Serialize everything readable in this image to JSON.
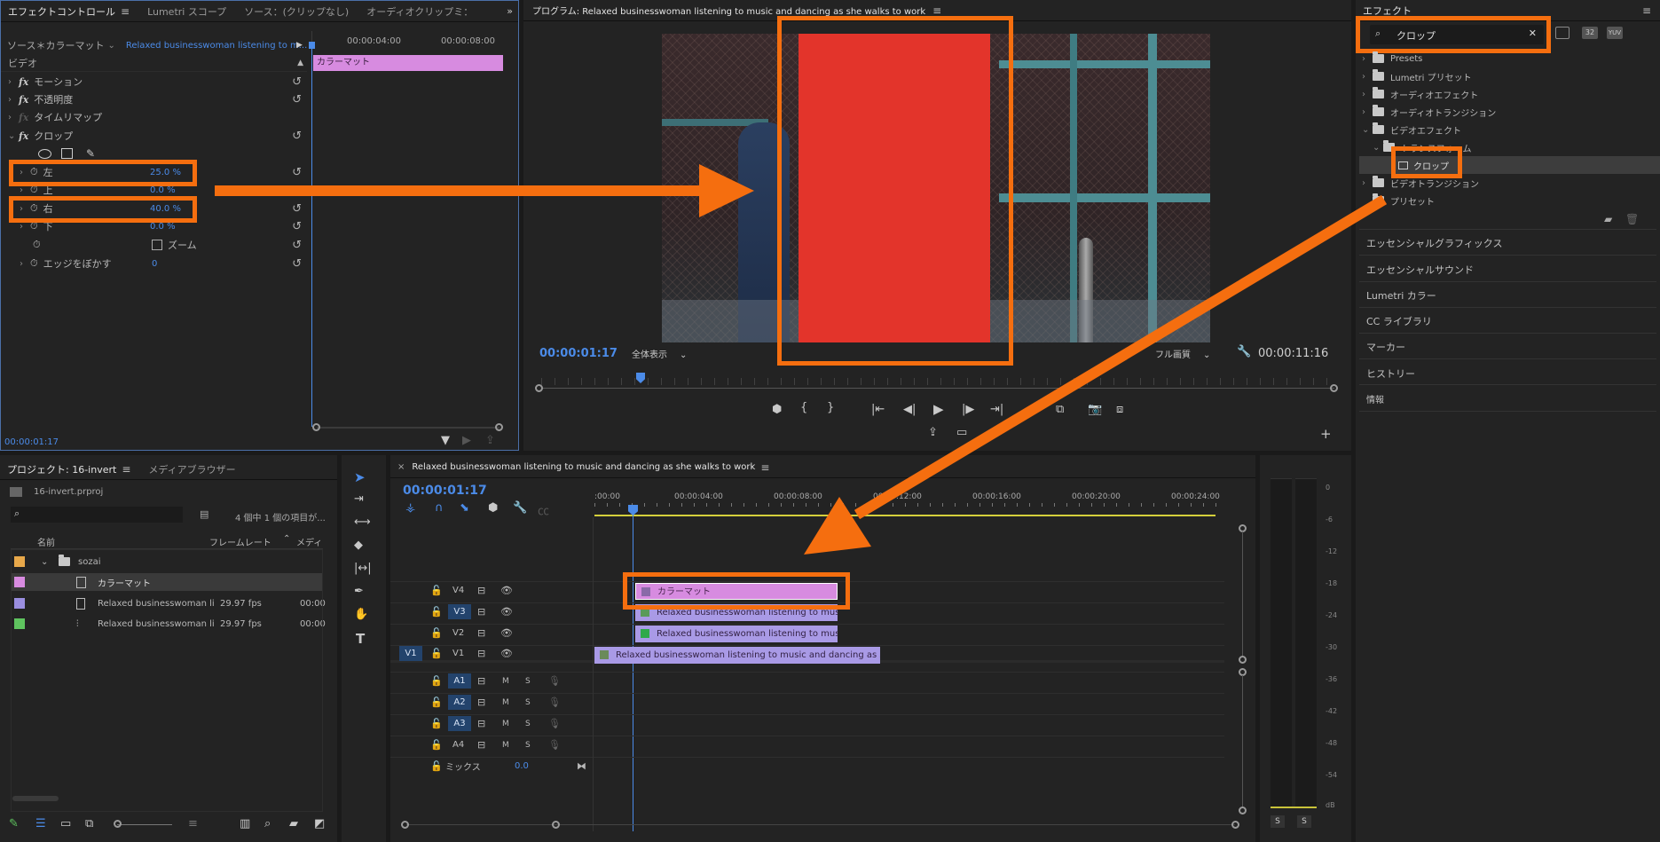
{
  "effect_controls": {
    "tabs": [
      "エフェクトコントロール",
      "Lumetri スコープ",
      "ソース：(クリップなし)",
      "オーディオクリップミ："
    ],
    "source_label": "ソース＊カラーマット",
    "clip_label": "Relaxed businesswoman listening to m...",
    "ruler_ticks": [
      "00:00:04:00",
      "00:00:08:00"
    ],
    "clip_bar_label": "カラーマット",
    "video_header": "ビデオ",
    "rows": [
      {
        "label": "モーション",
        "type": "fx"
      },
      {
        "label": "不透明度",
        "type": "fx"
      },
      {
        "label": "タイムリマップ",
        "type": "fx-dim"
      },
      {
        "label": "クロップ",
        "type": "fx-open"
      }
    ],
    "params": [
      {
        "label": "左",
        "value": "25.0 %"
      },
      {
        "label": "上",
        "value": "0.0 %"
      },
      {
        "label": "右",
        "value": "40.0 %"
      },
      {
        "label": "下",
        "value": "0.0 %"
      }
    ],
    "zoom_label": "ズーム",
    "feather_label": "エッジをぼかす",
    "feather_value": "0",
    "timecode": "00:00:01:17"
  },
  "program": {
    "title": "プログラム: Relaxed businesswoman listening to music and dancing as she walks to work",
    "timecode_left": "00:00:01:17",
    "zoom_select": "全体表示",
    "quality_select": "フル画質",
    "timecode_right": "00:00:11:16"
  },
  "effects": {
    "title": "エフェクト",
    "search_value": "クロップ",
    "tree": [
      {
        "label": "Presets",
        "level": 0,
        "expanded": false
      },
      {
        "label": "Lumetri プリセット",
        "level": 0,
        "expanded": false
      },
      {
        "label": "オーディオエフェクト",
        "level": 0,
        "expanded": false
      },
      {
        "label": "オーディオトランジション",
        "level": 0,
        "expanded": false
      },
      {
        "label": "ビデオエフェクト",
        "level": 0,
        "expanded": true
      },
      {
        "label": "トランスフォーム",
        "level": 1,
        "expanded": true
      },
      {
        "label": "クロップ",
        "level": 2,
        "expanded": false
      },
      {
        "label": "ビデオトランジション",
        "level": 0,
        "expanded": false
      },
      {
        "label": "プリセット",
        "level": 0,
        "expanded": false
      }
    ],
    "panels": [
      "エッセンシャルグラフィックス",
      "エッセンシャルサウンド",
      "Lumetri カラー",
      "CC ライブラリ",
      "マーカー",
      "ヒストリー",
      "情報"
    ]
  },
  "project": {
    "tabs": [
      "プロジェクト: 16-invert",
      "メディアブラウザー"
    ],
    "file": "16-invert.prproj",
    "count": "4 個中 1 個の項目が...",
    "columns": [
      "名前",
      "フレームレート",
      "メディ"
    ],
    "items": [
      {
        "name": "sozai",
        "fps": "",
        "media": "",
        "color": "#e8a84a",
        "kind": "bin"
      },
      {
        "name": "カラーマット",
        "fps": "",
        "media": "",
        "color": "#d88be0",
        "kind": "matte"
      },
      {
        "name": "Relaxed businesswoman li",
        "fps": "29.97 fps",
        "media": "00:00",
        "color": "#9a8ee0",
        "kind": "video"
      },
      {
        "name": "Relaxed businesswoman li",
        "fps": "29.97 fps",
        "media": "00:00",
        "color": "#5fc45f",
        "kind": "seq"
      }
    ]
  },
  "timeline": {
    "title": "Relaxed businesswoman listening to music and dancing as she walks to work",
    "timecode": "00:00:01:17",
    "ruler": [
      ":00:00",
      "00:00:04:00",
      "00:00:08:00",
      "00:00:12:00",
      "00:00:16:00",
      "00:00:20:00",
      "00:00:24:00"
    ],
    "video_tracks": [
      "V4",
      "V3",
      "V2",
      "V1"
    ],
    "audio_tracks": [
      "A1",
      "A2",
      "A3",
      "A4"
    ],
    "mix_label": "ミックス",
    "mix_value": "0.0",
    "clips": {
      "v4": "カラーマット",
      "v3": "Relaxed businesswoman listening to music a",
      "v2": "Relaxed businesswoman listening to music a",
      "v1": "Relaxed businesswoman listening to music and dancing as she wal"
    }
  },
  "meter": {
    "scale": [
      "0",
      "-6",
      "-12",
      "-18",
      "-24",
      "-30",
      "-36",
      "-42",
      "-48",
      "-54",
      "dB"
    ],
    "solo": [
      "S",
      "S"
    ]
  },
  "colors": {
    "accent": "#4b8be8",
    "highlight": "#f56e0f",
    "matte": "#e3342b",
    "clip_pink": "#d78be0",
    "clip_purple": "#a99ae6"
  }
}
